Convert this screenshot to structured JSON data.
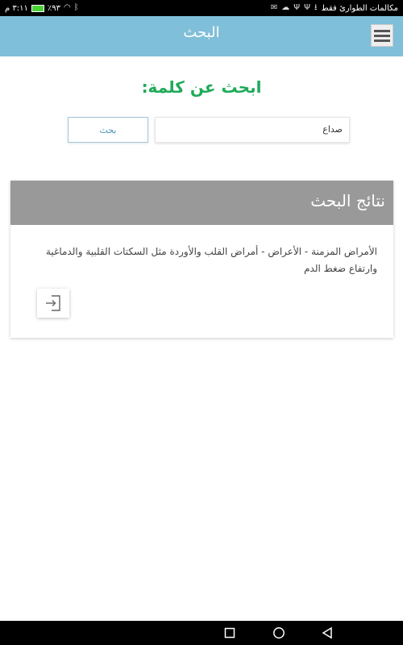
{
  "status_bar": {
    "time": "٣:١١ م",
    "battery": "٪٩٣",
    "carrier": "مكالمات الطوارئ فقط"
  },
  "app_bar": {
    "title": "البحث",
    "menu_icon": "hamburger-menu-icon"
  },
  "search": {
    "heading": "ابحث عن كلمة:",
    "input_value": "صداع",
    "button_label": "بحث"
  },
  "results": {
    "header": "نتائج البحث",
    "items": [
      {
        "text": "الأمراض المزمنة - الأعراض - أمراض القلب والأوردة مثل السكتات القلبية والدماغية وارتفاع ضغط الدم",
        "action_icon": "enter-icon"
      }
    ]
  },
  "nav_bar": {
    "icons": [
      "recents-square-icon",
      "home-circle-icon",
      "back-triangle-icon"
    ]
  },
  "colors": {
    "app_bar": "#7fbfd9",
    "heading": "#1faa59",
    "results_header": "#999999"
  }
}
